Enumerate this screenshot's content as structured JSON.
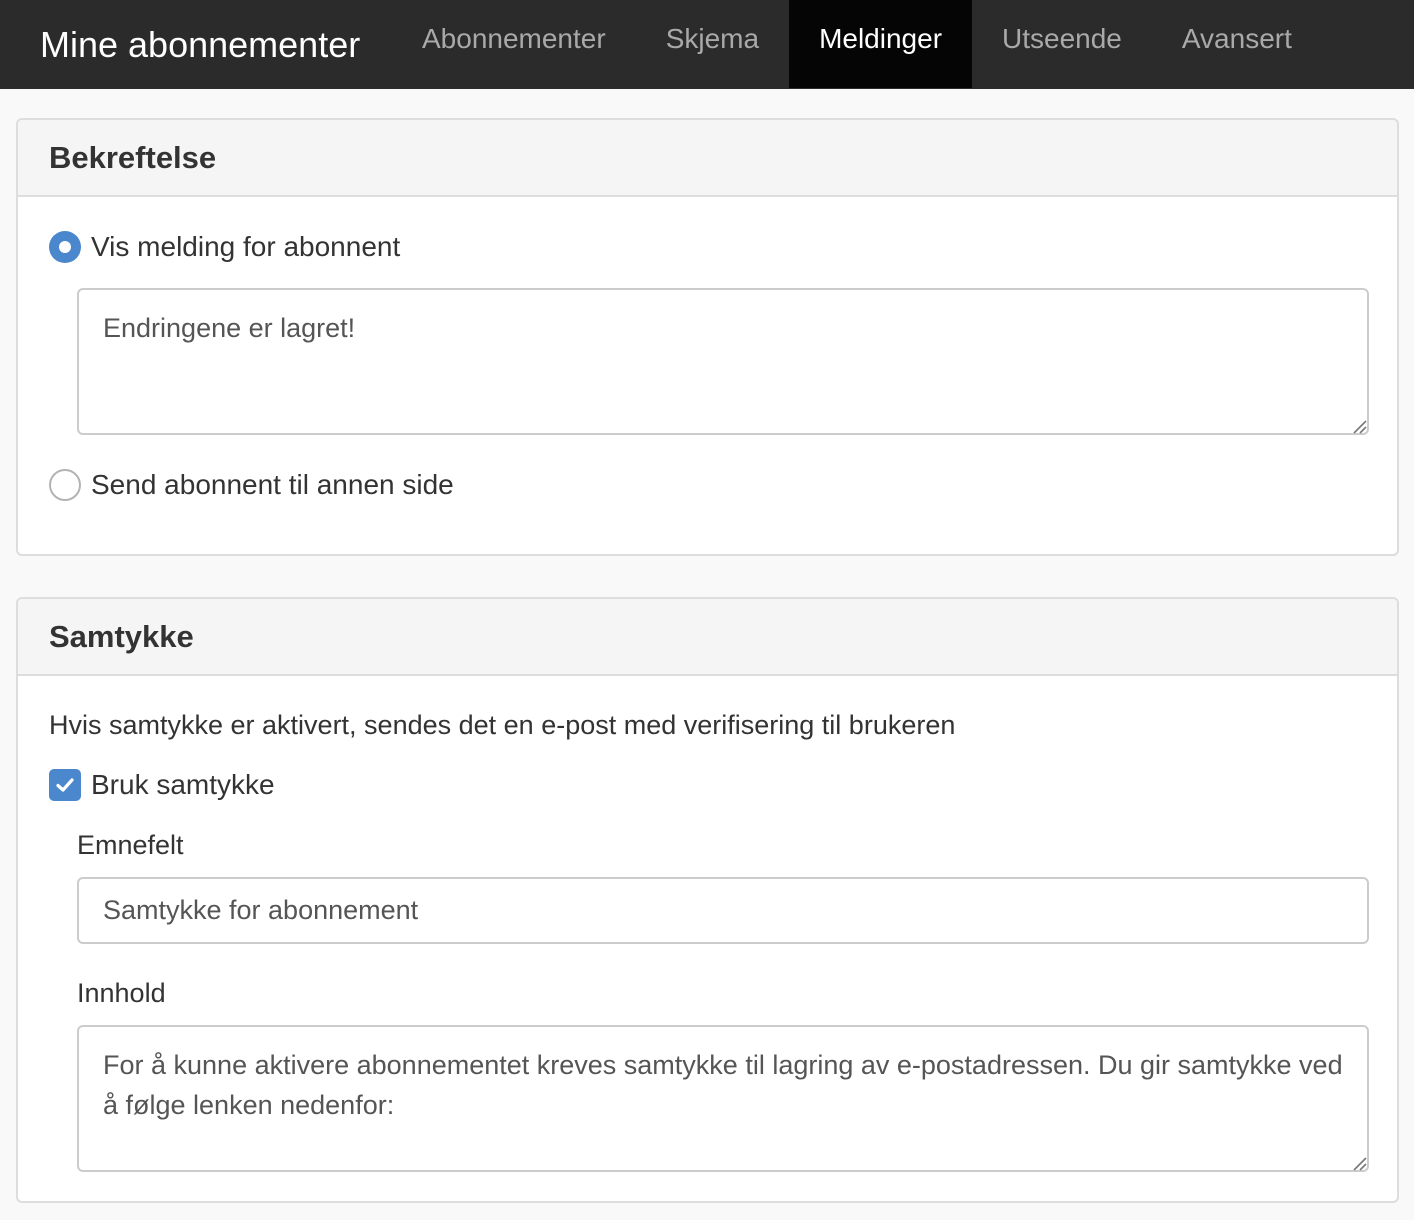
{
  "navbar": {
    "brand": "Mine abonnementer",
    "tabs": [
      {
        "label": "Abonnementer",
        "active": false
      },
      {
        "label": "Skjema",
        "active": false
      },
      {
        "label": "Meldinger",
        "active": true
      },
      {
        "label": "Utseende",
        "active": false
      },
      {
        "label": "Avansert",
        "active": false
      }
    ]
  },
  "confirmation": {
    "title": "Bekreftelse",
    "show_message_label": "Vis melding for abonnent",
    "message_value": "Endringene er lagret!",
    "redirect_label": "Send abonnent til annen side",
    "selected": "show_message"
  },
  "consent": {
    "title": "Samtykke",
    "help_text": "Hvis samtykke er aktivert, sendes det en e-post med verifisering til brukeren",
    "use_consent_label": "Bruk samtykke",
    "use_consent_checked": true,
    "subject_label": "Emnefelt",
    "subject_value": "Samtykke for abonnement",
    "content_label": "Innhold",
    "content_value": "For å kunne aktivere abonnementet kreves samtykke til lagring av e-postadressen. Du gir samtykke ved å følge lenken nedenfor:"
  },
  "colors": {
    "navbar_bg": "#2b2b2b",
    "active_tab_bg": "#050505",
    "accent": "#4a87cc"
  }
}
